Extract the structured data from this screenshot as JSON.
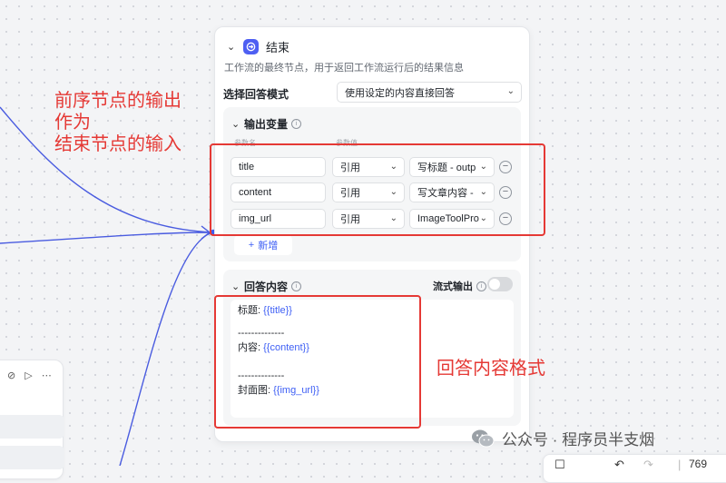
{
  "annotations": {
    "left_lines": [
      "前序节点的输出",
      "作为",
      "结束节点的输入"
    ],
    "right_label": "回答内容格式"
  },
  "node": {
    "title": "结束",
    "description": "工作流的最终节点，用于返回工作流运行后的结果信息",
    "mode_label": "选择回答模式",
    "mode_value": "使用设定的内容直接回答"
  },
  "output_section": {
    "title": "输出变量",
    "col_name": "参数名",
    "col_value": "参数值",
    "rows": [
      {
        "name": "title",
        "ref": "引用",
        "value": "写标题 - outp"
      },
      {
        "name": "content",
        "ref": "引用",
        "value": "写文章内容 -"
      },
      {
        "name": "img_url",
        "ref": "引用",
        "value": "ImageToolPro"
      }
    ],
    "add_label": "新增"
  },
  "answer_section": {
    "title": "回答内容",
    "stream_label": "流式输出",
    "stream_enabled": false,
    "lines": [
      {
        "label": "标题: ",
        "var": "{{title}}"
      },
      {
        "label": "--------------",
        "var": ""
      },
      {
        "label": "内容: ",
        "var": "{{content}}"
      },
      {
        "label": "--------------",
        "var": ""
      },
      {
        "label": "封面图: ",
        "var": "{{img_url}}"
      }
    ]
  },
  "watermark": "公众号 · 程序员半支烟",
  "toolbar": {
    "zoom": "769"
  },
  "colors": {
    "accent": "#3e5ff5",
    "node_icon": "#4e5ff2",
    "annotation": "#e53935",
    "wire": "#4a5ce0"
  },
  "icons": [
    "chevron-down-icon",
    "end-node-icon",
    "info-icon",
    "plus-icon",
    "minus-circle-icon",
    "play-icon",
    "more-icon",
    "wechat-icon"
  ]
}
